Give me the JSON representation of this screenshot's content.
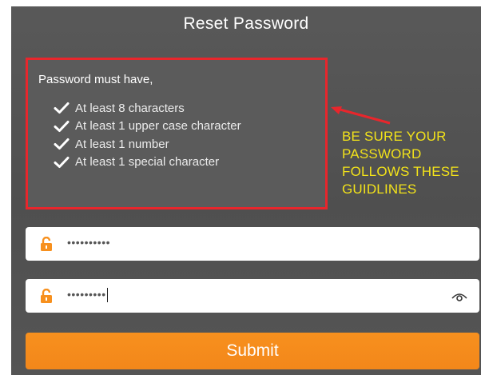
{
  "form": {
    "title": "Reset Password",
    "requirements": {
      "heading": "Password must have,",
      "items": [
        "At least 8 characters",
        "At least 1 upper case character",
        "At least 1 number",
        "At least 1 special character"
      ]
    },
    "password_field": {
      "value": "••••••••••"
    },
    "confirm_field": {
      "value": "•••••••••"
    },
    "submit_label": "Submit"
  },
  "annotation": {
    "lines": [
      "BE SURE YOUR",
      "PASSWORD",
      "FOLLOWS THESE",
      "GUIDLINES"
    ]
  },
  "icons": {
    "check": "check-icon",
    "lock": "lock-icon",
    "eye": "eye-icon"
  },
  "colors": {
    "panel_bg": "#555555",
    "highlight_border": "#e8262c",
    "annotation_text": "#f2e21a",
    "lock_icon": "#f7901e",
    "submit_bg": "#f7901e"
  }
}
